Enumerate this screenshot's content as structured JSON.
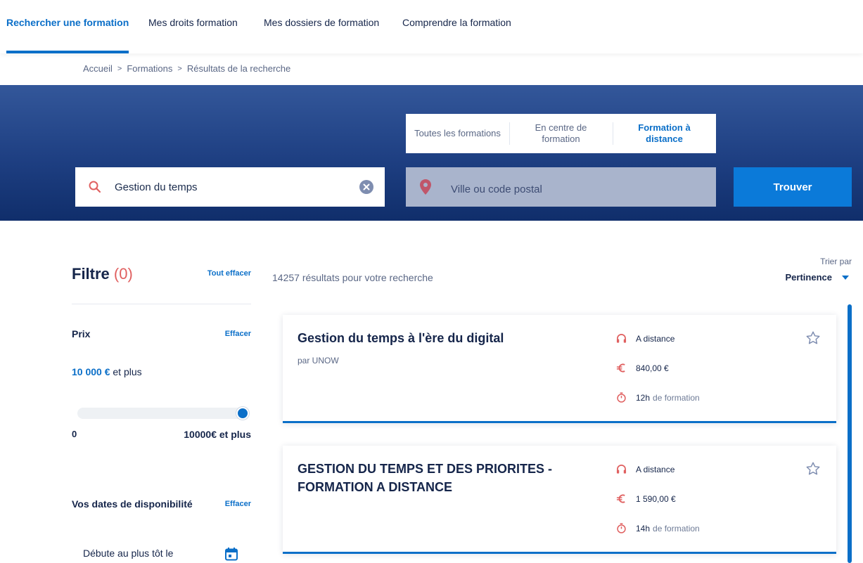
{
  "nav": {
    "items": [
      {
        "label": "Rechercher une formation"
      },
      {
        "label": "Mes droits formation"
      },
      {
        "label": "Mes dossiers de formation"
      },
      {
        "label": "Comprendre la formation"
      }
    ]
  },
  "breadcrumb": {
    "items": [
      "Accueil",
      "Formations",
      "Résultats de la recherche"
    ]
  },
  "search": {
    "tabs": [
      {
        "label": "Toutes les formations"
      },
      {
        "label": "En centre de formation"
      },
      {
        "label": "Formation à distance"
      }
    ],
    "query": "Gestion du temps",
    "city_placeholder": "Ville ou code postal",
    "find_label": "Trouver"
  },
  "filters": {
    "title": "Filtre",
    "count": "(0)",
    "clear_all": "Tout effacer",
    "price": {
      "label": "Prix",
      "clear": "Effacer",
      "amount": "10 000 €",
      "suffix": "et plus",
      "min_label": "0",
      "max_label": "10000€ et plus",
      "slider_value_fraction": 1.0
    },
    "dates": {
      "label": "Vos dates de disponibilité",
      "clear": "Effacer",
      "start_label": "Débute au plus tôt le"
    }
  },
  "results": {
    "count_text": "14257 résultats pour votre recherche",
    "sort_label": "Trier par",
    "sort_value": "Pertinence",
    "cards": [
      {
        "title": "Gestion du temps à l'ère du digital",
        "org": "par UNOW",
        "mode": "A distance",
        "price": "840,00 €",
        "duration": "12h",
        "duration_suffix": "de formation"
      },
      {
        "title": "GESTION DU TEMPS ET DES PRIORITES - FORMATION A DISTANCE",
        "org": "",
        "mode": "A distance",
        "price": "1 590,00 €",
        "duration": "14h",
        "duration_suffix": "de formation"
      }
    ]
  },
  "colors": {
    "primary": "#0b6fc8",
    "accent_red": "#e06060",
    "hero_top": "#33579a",
    "hero_bottom": "#102e6b"
  }
}
